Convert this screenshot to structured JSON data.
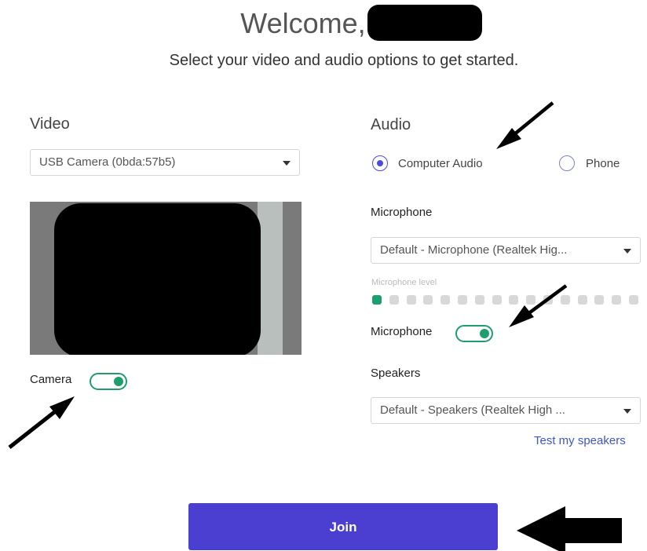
{
  "header": {
    "welcome": "Welcome,",
    "subtitle": "Select your video and audio options to get started."
  },
  "video": {
    "title": "Video",
    "camera_select": "USB Camera (0bda:57b5)",
    "camera_label": "Camera",
    "camera_on": true
  },
  "audio": {
    "title": "Audio",
    "options": [
      {
        "label": "Computer Audio",
        "selected": true
      },
      {
        "label": "Phone",
        "selected": false
      }
    ],
    "microphone_title": "Microphone",
    "microphone_select": "Default - Microphone (Realtek Hig...",
    "mic_level_label": "Microphone level",
    "mic_level_active_dots": 1,
    "mic_level_total_dots": 16,
    "microphone_toggle_label": "Microphone",
    "microphone_on": true,
    "speakers_title": "Speakers",
    "speakers_select": "Default - Speakers (Realtek High ...",
    "test_speakers": "Test my speakers"
  },
  "actions": {
    "join": "Join"
  },
  "colors": {
    "accent": "#4b3fd2",
    "toggle_green": "#1f9d6c",
    "link": "#3e55c8"
  }
}
